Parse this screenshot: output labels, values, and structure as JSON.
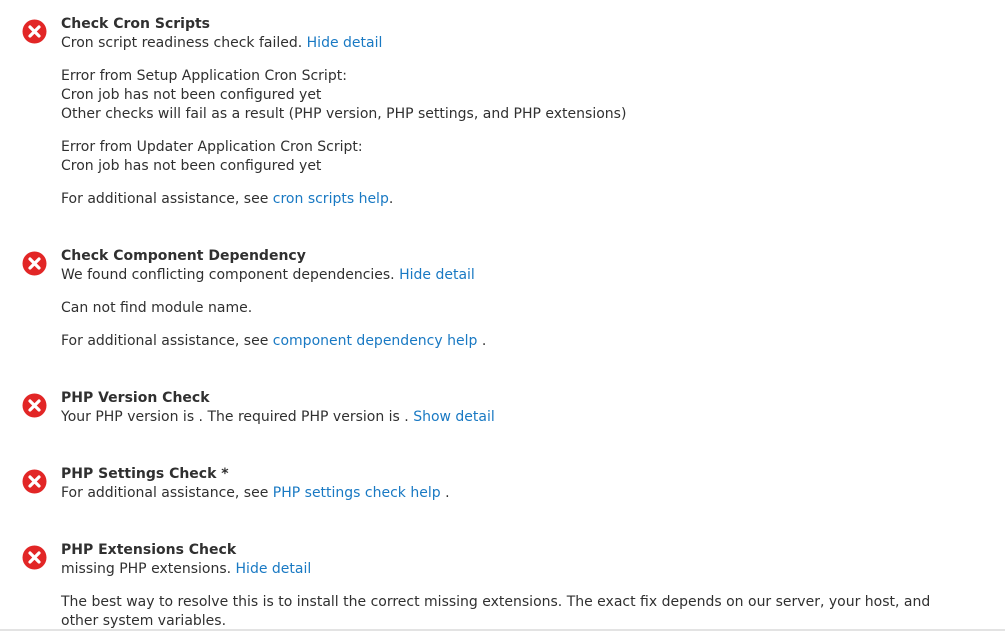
{
  "checks": {
    "cron": {
      "title": "Check Cron Scripts",
      "summary": "Cron script readiness check failed. ",
      "toggle": "Hide detail",
      "setup_error_heading": "Error from Setup Application Cron Script:",
      "setup_error_line1": "Cron job has not been configured yet",
      "setup_error_line2": "Other checks will fail as a result (PHP version, PHP settings, and PHP extensions)",
      "updater_error_heading": "Error from Updater Application Cron Script:",
      "updater_error_line1": "Cron job has not been configured yet",
      "help_prefix": "For additional assistance, see ",
      "help_link": "cron scripts help",
      "help_suffix": "."
    },
    "dependency": {
      "title": "Check Component Dependency",
      "summary": "We found conflicting component dependencies. ",
      "toggle": "Hide detail",
      "detail": "Can not find module name.",
      "help_prefix": "For additional assistance, see ",
      "help_link": "component dependency help",
      "help_suffix": " ."
    },
    "php_version": {
      "title": "PHP Version Check",
      "summary": "Your PHP version is . The required PHP version is . ",
      "toggle": "Show detail"
    },
    "php_settings": {
      "title": "PHP Settings Check *",
      "help_prefix": "For additional assistance, see ",
      "help_link": "PHP settings check help",
      "help_suffix": " ."
    },
    "php_extensions": {
      "title": "PHP Extensions Check",
      "summary": "missing PHP extensions. ",
      "toggle": "Hide detail",
      "detail": "The best way to resolve this is to install the correct missing extensions. The exact fix depends on our server, your host, and other system variables."
    }
  },
  "colors": {
    "error_icon": "#e22626",
    "link": "#1979c3",
    "text": "#303030"
  },
  "icons": {
    "status": "error-x-circle-icon"
  }
}
